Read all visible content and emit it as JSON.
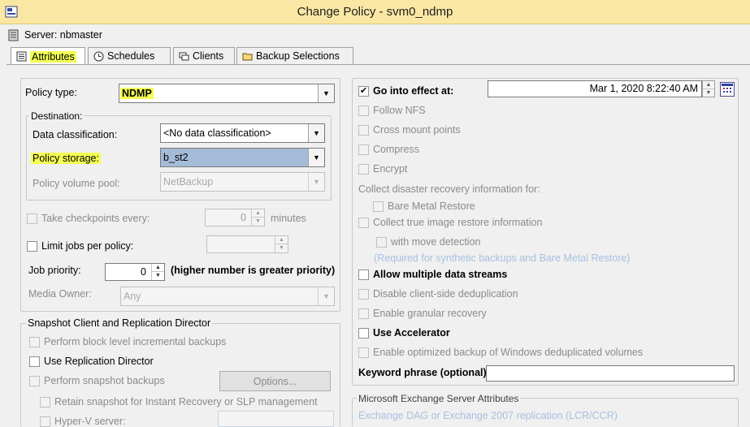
{
  "window": {
    "title": "Change Policy - svm0_ndmp",
    "server_label": "Server: nbmaster"
  },
  "tabs": [
    {
      "label": "Attributes"
    },
    {
      "label": "Schedules"
    },
    {
      "label": "Clients"
    },
    {
      "label": "Backup Selections"
    }
  ],
  "left": {
    "policy_type_label": "Policy type:",
    "policy_type_value": "NDMP",
    "destination_legend": "Destination:",
    "data_classification_label": "Data classification:",
    "data_classification_value": "<No data classification>",
    "policy_storage_label": "Policy storage:",
    "policy_storage_value": "b_st2",
    "policy_volume_pool_label": "Policy volume pool:",
    "policy_volume_pool_value": "NetBackup",
    "take_checkpoints_label": "Take checkpoints every:",
    "take_checkpoints_value": "0",
    "minutes_label": "minutes",
    "limit_jobs_label": "Limit jobs per policy:",
    "job_priority_label": "Job priority:",
    "job_priority_value": "0",
    "job_priority_hint": "(higher number is greater priority)",
    "media_owner_label": "Media Owner:",
    "media_owner_value": "Any",
    "snapshot_legend": "Snapshot Client and Replication Director",
    "block_level_label": "Perform block level incremental backups",
    "replication_director_label": "Use Replication Director",
    "snapshot_backups_label": "Perform snapshot backups",
    "options_button": "Options...",
    "retain_snapshot_label": "Retain snapshot for Instant Recovery or SLP management",
    "hyperv_label": "Hyper-V server:"
  },
  "right": {
    "go_into_effect_label": "Go into effect at:",
    "go_into_effect_value": "Mar 1, 2020 8:22:40 AM",
    "follow_nfs_label": "Follow NFS",
    "cross_mount_label": "Cross mount points",
    "compress_label": "Compress",
    "encrypt_label": "Encrypt",
    "disaster_recovery_label": "Collect disaster recovery information for:",
    "bare_metal_label": "Bare Metal Restore",
    "true_image_label": "Collect true image restore information",
    "move_detection_label": "with move detection",
    "required_note": "(Required for synthetic backups and Bare Metal Restore)",
    "multiple_streams_label": "Allow multiple data streams",
    "client_dedup_label": "Disable client-side deduplication",
    "granular_label": "Enable granular recovery",
    "accelerator_label": "Use Accelerator",
    "optimized_backup_label": "Enable optimized backup of Windows deduplicated volumes",
    "keyword_label": "Keyword phrase (optional):",
    "keyword_value": "",
    "exchange_legend": "Microsoft Exchange Server Attributes",
    "exchange_note": "Exchange DAG or Exchange 2007 replication (LCR/CCR)"
  },
  "colors": {
    "title_bar": "#fbe7a4",
    "highlight": "#f4ff54",
    "selected_combo": "#a5bcd9",
    "note_text": "#a8c0e0"
  },
  "icons": [
    "app-icon",
    "server-icon",
    "attributes-icon",
    "schedules-icon",
    "clients-icon",
    "backup-selections-icon",
    "calendar-icon",
    "chevron-down-icon",
    "close-icon"
  ]
}
